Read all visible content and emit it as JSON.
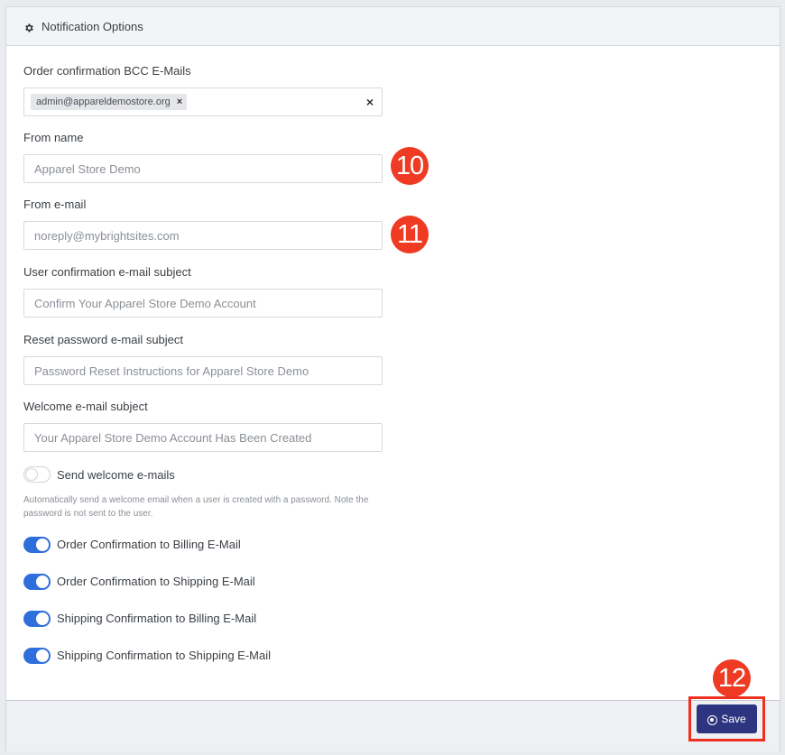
{
  "header": {
    "title": "Notification Options",
    "icon": "gear-icon"
  },
  "bcc": {
    "label": "Order confirmation BCC E-Mails",
    "tags": [
      "admin@appareldemostore.org"
    ],
    "tag_remove": "×",
    "clear": "×"
  },
  "from_name": {
    "label": "From name",
    "placeholder": "Apparel Store Demo"
  },
  "from_email": {
    "label": "From e-mail",
    "placeholder": "noreply@mybrightsites.com"
  },
  "user_confirm_subject": {
    "label": "User confirmation e-mail subject",
    "placeholder": "Confirm Your Apparel Store Demo Account"
  },
  "reset_subject": {
    "label": "Reset password e-mail subject",
    "placeholder": "Password Reset Instructions for Apparel Store Demo"
  },
  "welcome_subject": {
    "label": "Welcome e-mail subject",
    "placeholder": "Your Apparel Store Demo Account Has Been Created"
  },
  "toggles": {
    "welcome": {
      "label": "Send welcome e-mails",
      "on": false,
      "help": "Automatically send a welcome email when a user is created with a password. Note the password is not sent to the user."
    },
    "order_billing": {
      "label": "Order Confirmation to Billing E-Mail",
      "on": true
    },
    "order_shipping": {
      "label": "Order Confirmation to Shipping E-Mail",
      "on": true
    },
    "ship_billing": {
      "label": "Shipping Confirmation to Billing E-Mail",
      "on": true
    },
    "ship_shipping": {
      "label": "Shipping Confirmation to Shipping E-Mail",
      "on": true
    }
  },
  "annotations": {
    "badge_10": "10",
    "badge_11": "11",
    "badge_12": "12",
    "badge_color": "#ef3b24"
  },
  "footer": {
    "save_label": "Save",
    "accent": "#2d3580"
  }
}
